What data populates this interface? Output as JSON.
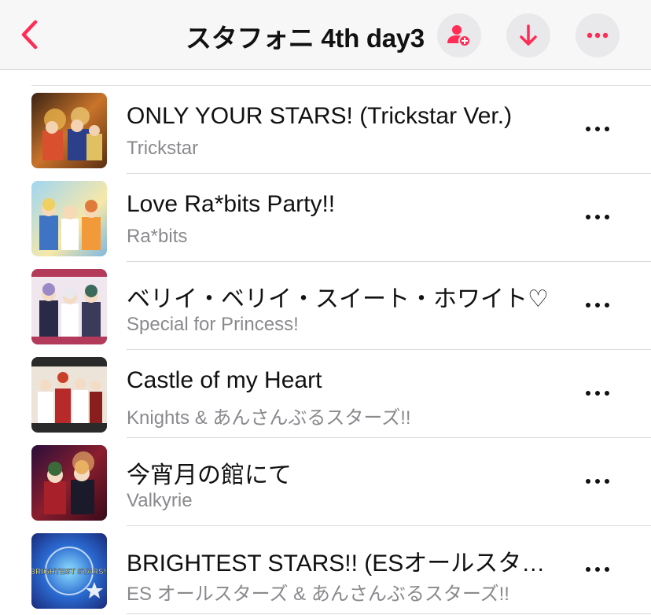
{
  "header": {
    "title": "スタフォニ 4th day3",
    "back_icon": "chevron-left-icon",
    "buttons": [
      {
        "icon": "add-user-icon"
      },
      {
        "icon": "download-arrow-icon"
      },
      {
        "icon": "ellipsis-icon"
      }
    ],
    "accent_color": "#ff2d55"
  },
  "songs": [
    {
      "title": "ONLY YOUR STARS! (Trickstar Ver.)",
      "artist": "Trickstar"
    },
    {
      "title": "Love Ra*bits Party!!",
      "artist": "Ra*bits"
    },
    {
      "title": "ベリイ・ベリイ・スイート・ホワイト♡",
      "artist": "Special for Princess!"
    },
    {
      "title": "Castle of my Heart",
      "artist": "Knights & あんさんぶるスターズ!!"
    },
    {
      "title": "今宵月の館にて",
      "artist": "Valkyrie"
    },
    {
      "title": "BRIGHTEST STARS!! (ESオールスターズ & あんさんぶるスターズ!!)",
      "artist": "ES オールスターズ & あんさんぶるスターズ!!"
    }
  ],
  "art_texts": {
    "brightest": "BRIGHTEST STARS!!"
  }
}
